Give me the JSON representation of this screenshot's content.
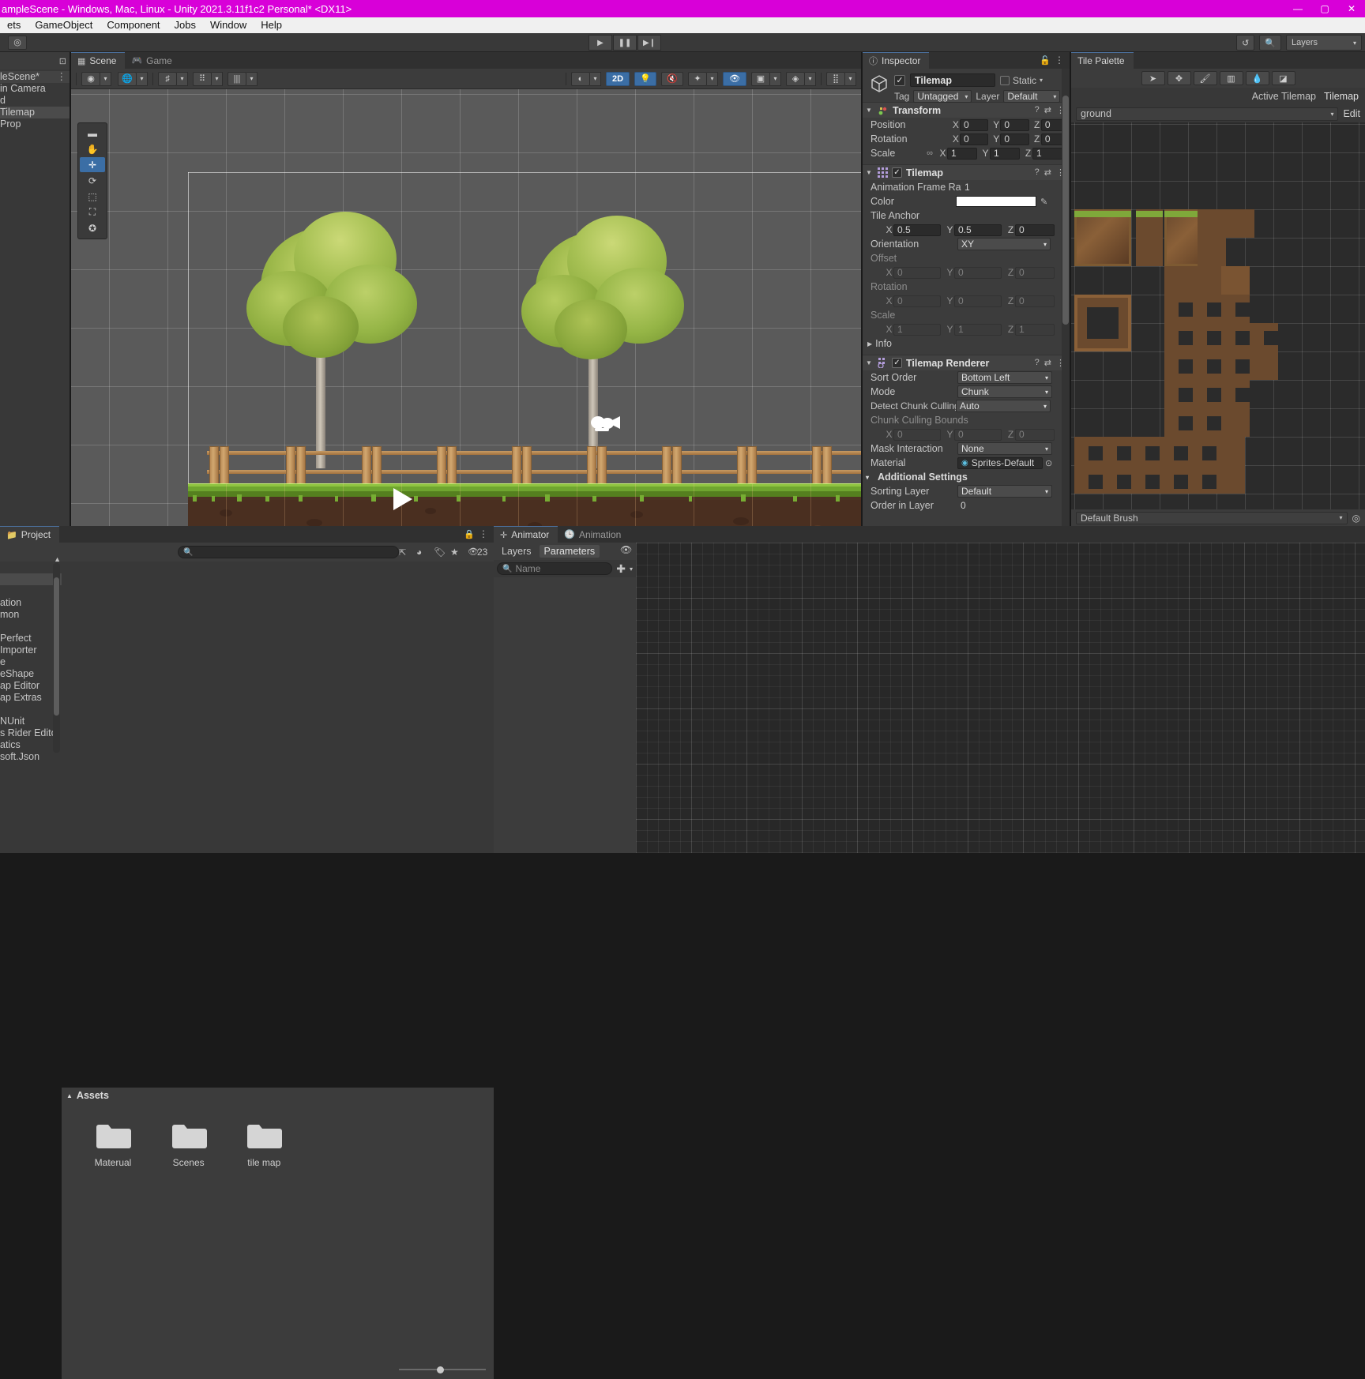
{
  "window": {
    "title": "ampleScene - Windows, Mac, Linux - Unity 2021.3.11f1c2 Personal* <DX11>",
    "minimize": "—",
    "maximize": "▢",
    "close": "✕"
  },
  "menu": {
    "items": [
      "ets",
      "GameObject",
      "Component",
      "Jobs",
      "Window",
      "Help"
    ]
  },
  "toolbar": {
    "account_icon": "◎",
    "play": "▶",
    "pause": "❚❚",
    "step": "▶❙",
    "history_icon": "↺",
    "search_icon": "🔍",
    "layers_label": "Layers",
    "layers_caret": "▾"
  },
  "hierarchy": {
    "create_icon": "⊡",
    "items": [
      {
        "label": "leScene*",
        "selected": false,
        "is_scene": true,
        "dots": "⋮"
      },
      {
        "label": "in Camera",
        "selected": false,
        "is_scene": false
      },
      {
        "label": "d",
        "selected": false,
        "is_scene": false
      },
      {
        "label": "Tilemap",
        "selected": true,
        "is_scene": false
      },
      {
        "label": "Prop",
        "selected": false,
        "is_scene": false
      }
    ]
  },
  "scene": {
    "tabs": [
      {
        "label": "Scene",
        "icon": "▦",
        "active": true
      },
      {
        "label": "Game",
        "icon": "🎮",
        "active": false
      }
    ],
    "left_tools": [
      {
        "name": "draw-mode",
        "glyph": "◉"
      },
      {
        "name": "shading-mode",
        "glyph": "🌐"
      },
      {
        "name": "2d-grid-toggle",
        "glyph": "♯"
      },
      {
        "name": "gizmo-grid",
        "glyph": "⠿"
      },
      {
        "name": "grid-snap",
        "glyph": "|||"
      }
    ],
    "right_tools": [
      {
        "name": "shading-sphere",
        "glyph": "◐",
        "on": false
      },
      {
        "name": "2d-toggle",
        "glyph": "2D",
        "on": true
      },
      {
        "name": "lighting-toggle",
        "glyph": "💡",
        "on": true
      },
      {
        "name": "audio-toggle",
        "glyph": "🔇",
        "on": false
      },
      {
        "name": "fx-toggle",
        "glyph": "✦",
        "on": false
      },
      {
        "name": "hidden-objects-toggle",
        "glyph": "👁",
        "on": true
      },
      {
        "name": "camera-settings",
        "glyph": "▣",
        "on": false
      },
      {
        "name": "gizmos-toggle",
        "glyph": "◈",
        "on": false
      },
      {
        "name": "scene-visibility",
        "glyph": "⣿",
        "on": false
      }
    ],
    "overlay_tools": [
      {
        "name": "tool-handle",
        "glyph": "▬",
        "active": false
      },
      {
        "name": "hand-tool",
        "glyph": "✋",
        "active": false
      },
      {
        "name": "move-tool",
        "glyph": "✛",
        "active": true
      },
      {
        "name": "rotate-tool",
        "glyph": "⟳",
        "active": false
      },
      {
        "name": "scale-tool",
        "glyph": "⬚",
        "active": false
      },
      {
        "name": "rect-tool",
        "glyph": "⛶",
        "active": false
      },
      {
        "name": "transform-tool",
        "glyph": "✪",
        "active": false
      }
    ],
    "play_overlay_glyph": "▶"
  },
  "inspector": {
    "tab_label": "Inspector",
    "tab_icon": "ⓘ",
    "lock_icon": "🔓",
    "dots_icon": "⋮",
    "gameobject": {
      "enabled": true,
      "name": "Tilemap",
      "static_label": "Static",
      "static_checked": false,
      "tag_label": "Tag",
      "tag_value": "Untagged",
      "layer_label": "Layer",
      "layer_value": "Default"
    },
    "components": [
      {
        "title": "Transform",
        "icon": "⚙",
        "has_checkbox": false,
        "help_icon": "?",
        "preset_icon": "⇄",
        "menu_icon": "⋮",
        "rows": [
          {
            "label": "Position",
            "fields": [
              [
                "X",
                "0"
              ],
              [
                "Y",
                "0"
              ],
              [
                "Z",
                "0"
              ]
            ]
          },
          {
            "label": "Rotation",
            "fields": [
              [
                "X",
                "0"
              ],
              [
                "Y",
                "0"
              ],
              [
                "Z",
                "0"
              ]
            ]
          },
          {
            "label": "Scale",
            "link": "∞",
            "fields": [
              [
                "X",
                "1"
              ],
              [
                "Y",
                "1"
              ],
              [
                "Z",
                "1"
              ]
            ]
          }
        ]
      },
      {
        "title": "Tilemap",
        "icon": "▦",
        "has_checkbox": true,
        "checked": true,
        "help_icon": "?",
        "preset_icon": "⇄",
        "menu_icon": "⋮",
        "animation_frame_rate_label": "Animation Frame Rate",
        "animation_frame_rate_value": "1",
        "color_label": "Color",
        "color_value": "#FFFFFF",
        "eyedropper_icon": "✎",
        "tile_anchor_label": "Tile Anchor",
        "tile_anchor": [
          [
            "X",
            "0.5"
          ],
          [
            "Y",
            "0.5"
          ],
          [
            "Z",
            "0"
          ]
        ],
        "orientation_label": "Orientation",
        "orientation_value": "XY",
        "offset_label": "Offset",
        "offset": [
          [
            "X",
            "0"
          ],
          [
            "Y",
            "0"
          ],
          [
            "Z",
            "0"
          ]
        ],
        "rotation_label": "Rotation",
        "rotation": [
          [
            "X",
            "0"
          ],
          [
            "Y",
            "0"
          ],
          [
            "Z",
            "0"
          ]
        ],
        "scale_label": "Scale",
        "scale": [
          [
            "X",
            "1"
          ],
          [
            "Y",
            "1"
          ],
          [
            "Z",
            "1"
          ]
        ],
        "info_label": "Info",
        "info_tri": "▶"
      },
      {
        "title": "Tilemap Renderer",
        "icon": "▩",
        "has_checkbox": true,
        "checked": true,
        "help_icon": "?",
        "preset_icon": "⇄",
        "menu_icon": "⋮",
        "rows": [
          {
            "label": "Sort Order",
            "value": "Bottom Left",
            "type": "dropdown"
          },
          {
            "label": "Mode",
            "value": "Chunk",
            "type": "dropdown"
          },
          {
            "label": "Detect Chunk Culling",
            "value": "Auto",
            "type": "dropdown"
          }
        ],
        "chunk_culling_bounds_label": "Chunk Culling Bounds",
        "chunk_culling_bounds": [
          [
            "X",
            "0"
          ],
          [
            "Y",
            "0"
          ],
          [
            "Z",
            "0"
          ]
        ],
        "mask_interaction_label": "Mask Interaction",
        "mask_interaction_value": "None",
        "material_label": "Material",
        "material_value": "Sprites-Default",
        "material_icon": "◉",
        "material_pick_icon": "⊙",
        "additional_settings_label": "Additional Settings",
        "additional_tri": "▾",
        "sorting_layer_label": "Sorting Layer",
        "sorting_layer_value": "Default",
        "order_in_layer_label": "Order in Layer",
        "order_in_layer_value": "0"
      }
    ]
  },
  "palette": {
    "tab_label": "Tile Palette",
    "tools": [
      {
        "name": "select-tool",
        "glyph": "➤"
      },
      {
        "name": "move-tool",
        "glyph": "✥"
      },
      {
        "name": "brush-tool",
        "glyph": "🖌"
      },
      {
        "name": "box-fill-tool",
        "glyph": "▥"
      },
      {
        "name": "picker-tool",
        "glyph": "💧"
      },
      {
        "name": "eraser-tool",
        "glyph": "◪"
      }
    ],
    "active_tilemap_label": "Active Tilemap",
    "active_tilemap_value": "Tilemap",
    "palette_name": "ground",
    "palette_caret": "▾",
    "edit_label": "Edit",
    "brush_label": "Default Brush",
    "brush_caret": "▾",
    "brush_target_icon": "◎"
  },
  "project": {
    "tab_label": "Project",
    "tab_icon": "📁",
    "lock_icon": "🔒",
    "dots_icon": "⋮",
    "search_icon": "🔍",
    "search_placeholder": "",
    "toolbar_icons": [
      {
        "name": "open-in-new-window-icon",
        "glyph": "⇱"
      },
      {
        "name": "filter-type-icon",
        "glyph": "◕"
      },
      {
        "name": "filter-label-icon",
        "glyph": "🏷"
      },
      {
        "name": "favorites-icon",
        "glyph": "★"
      },
      {
        "name": "item-count-icon",
        "glyph": "👁"
      }
    ],
    "item_count": "23",
    "tree": [
      {
        "label": "",
        "selected": false
      },
      {
        "label": "",
        "selected": true
      },
      {
        "label": "",
        "selected": false
      },
      {
        "label": "ation",
        "selected": false
      },
      {
        "label": "mon",
        "selected": false
      },
      {
        "label": "",
        "selected": false
      },
      {
        "label": "Perfect",
        "selected": false
      },
      {
        "label": "Importer",
        "selected": false
      },
      {
        "label": "e",
        "selected": false
      },
      {
        "label": "eShape",
        "selected": false
      },
      {
        "label": "ap Editor",
        "selected": false
      },
      {
        "label": "ap Extras",
        "selected": false
      },
      {
        "label": "",
        "selected": false
      },
      {
        "label": "NUnit",
        "selected": false
      },
      {
        "label": "s Rider Editor",
        "selected": false
      },
      {
        "label": "atics",
        "selected": false
      },
      {
        "label": "soft.Json",
        "selected": false
      }
    ],
    "assets_label": "Assets",
    "assets_tri": "▲",
    "assets": [
      {
        "label": "Materual",
        "type": "folder"
      },
      {
        "label": "Scenes",
        "type": "folder"
      },
      {
        "label": "tile map",
        "type": "folder"
      }
    ]
  },
  "animator": {
    "tabs": [
      {
        "label": "Animator",
        "icon": "✛",
        "active": true
      },
      {
        "label": "Animation",
        "icon": "🕒",
        "active": false
      }
    ],
    "subtabs": [
      {
        "label": "Layers",
        "selected": false
      },
      {
        "label": "Parameters",
        "selected": true
      }
    ],
    "eye_icon": "👁",
    "collapse_icon": "❯",
    "search_icon": "🔍",
    "name_placeholder": "Name",
    "add_icon": "✚",
    "add_caret": "▾"
  },
  "colors": {
    "title_bar": "#d800d8",
    "menu_bar": "#f0f0f0",
    "panel_bg": "#383838",
    "panel_body": "#3c3c3c",
    "accent_blue": "#3b6ea5",
    "text": "#c4c4c4"
  }
}
